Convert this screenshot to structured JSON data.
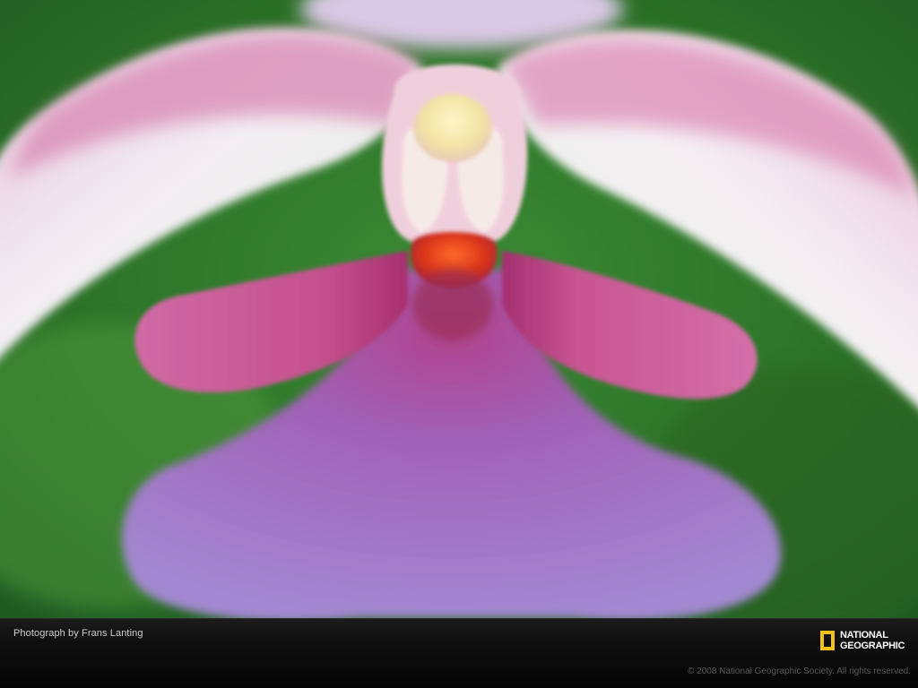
{
  "photo": {
    "subject": "orchid-flower-closeup",
    "colors": {
      "background_green": "#2f7a2a",
      "petal_pink": "#c9508f",
      "lip_violet": "#9b6fc4",
      "sepal_white": "#e9eee6",
      "center_orange": "#e2451c",
      "column_cream": "#f4eaa2"
    }
  },
  "caption_bar": {
    "credit": "Photograph by Frans Lanting",
    "copyright": "© 2008 National Geographic Society. All rights reserved."
  },
  "logo": {
    "line1": "NATIONAL",
    "line2": "GEOGRAPHIC",
    "frame_color": "#f1c21b",
    "icon": "yellow-rectangle-frame"
  }
}
